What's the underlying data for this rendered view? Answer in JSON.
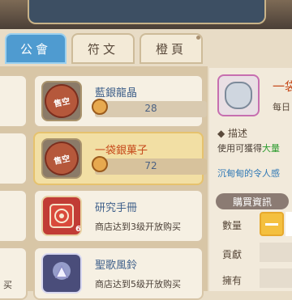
{
  "tabs": [
    {
      "label": "公會",
      "active": true
    },
    {
      "label": "符文",
      "active": false
    },
    {
      "label": "橙頁",
      "active": false
    }
  ],
  "items": [
    {
      "name": "藍銀龍晶",
      "price": "28",
      "name_color": "#3e5f8a",
      "icon": "seal-icon",
      "icon_text": "售空",
      "selected": false
    },
    {
      "name": "一袋銀菓子",
      "price": "72",
      "name_color": "#c64a1b",
      "icon": "seal-icon",
      "icon_text": "售空",
      "selected": true
    },
    {
      "name": "研究手冊",
      "notice": "商店达到3级开放购买",
      "name_color": "#3e5f8a",
      "icon": "red-book-icon",
      "badge": "6",
      "selected": false
    },
    {
      "name": "聖歌風鈴",
      "notice": "商店达到5级开放购买",
      "name_color": "#3e5f8a",
      "icon": "chime-icon",
      "selected": false
    }
  ],
  "left_edge_text": "买",
  "detail": {
    "title": "一袋",
    "subtitle": "每日",
    "desc_header": "描述",
    "desc_line1_prefix": "使用可獲得",
    "desc_line1_highlight": "大量",
    "desc_line2": "沉甸甸的令人感",
    "purchase_header": "購買資訊",
    "rows": [
      {
        "label": "數量"
      },
      {
        "label": "貢獻"
      },
      {
        "label": "擁有"
      }
    ]
  }
}
